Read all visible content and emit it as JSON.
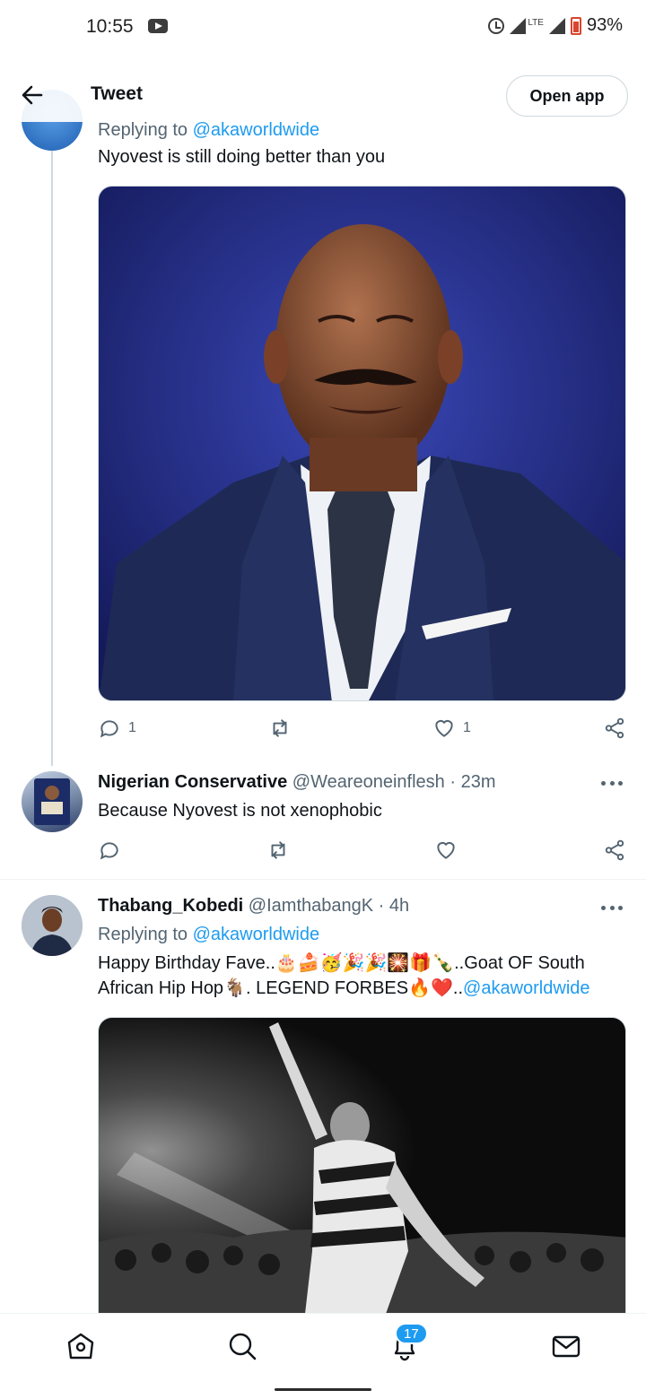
{
  "status_bar": {
    "time": "10:55",
    "lte": "LTE",
    "battery": "93%"
  },
  "header": {
    "title": "Tweet",
    "open_app": "Open app"
  },
  "tweets": [
    {
      "replying_prefix": "Replying to",
      "replying_to": "@akaworldwide",
      "text": "Nyovest is still doing better than you",
      "media": "Photo of a bald man with a moustache in a navy suit and tie",
      "replies": "1",
      "likes": "1"
    },
    {
      "name": "Nigerian Conservative",
      "handle": "@Weareoneinflesh",
      "time": "· 23m",
      "text": "Because Nyovest is not xenophobic"
    },
    {
      "name": "Thabang_Kobedi",
      "handle": "@IamthabangK",
      "time": "· 4h",
      "replying_prefix": "Replying to",
      "replying_to": "@akaworldwide",
      "text_main": "Happy Birthday Fave..🎂🍰🥳🎉🎉🎇🎁🍾..Goat OF South African Hip Hop🐐. LEGEND FORBES🔥❤️..",
      "text_mention": "@akaworldwide",
      "media": "Black-and-white photo of a performer pointing up on stage above a crowd"
    }
  ],
  "bottom_nav": {
    "notifications_badge": "17"
  },
  "colors": {
    "accent": "#1d9bf0",
    "secondary_text": "#536471",
    "primary_text": "#0f1419"
  }
}
